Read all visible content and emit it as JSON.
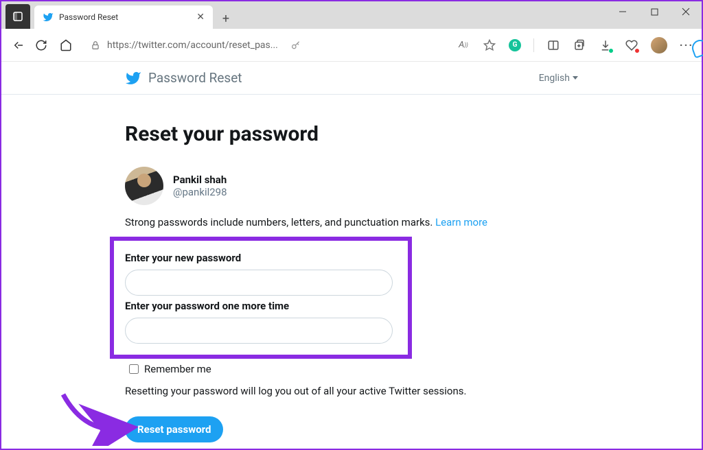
{
  "browser": {
    "tab_title": "Password Reset",
    "url": "https://twitter.com/account/reset_pas...",
    "language_selector": "English"
  },
  "page": {
    "header_title": "Password Reset",
    "heading": "Reset your password",
    "user": {
      "name": "Pankil shah",
      "handle": "@pankil298"
    },
    "hint_text": "Strong passwords include numbers, letters, and punctuation marks. ",
    "learn_more": "Learn more",
    "field1_label": "Enter your new password",
    "field2_label": "Enter your password one more time",
    "remember_label": "Remember me",
    "note": "Resetting your password will log you out of all your active Twitter sessions.",
    "button": "Reset password"
  }
}
